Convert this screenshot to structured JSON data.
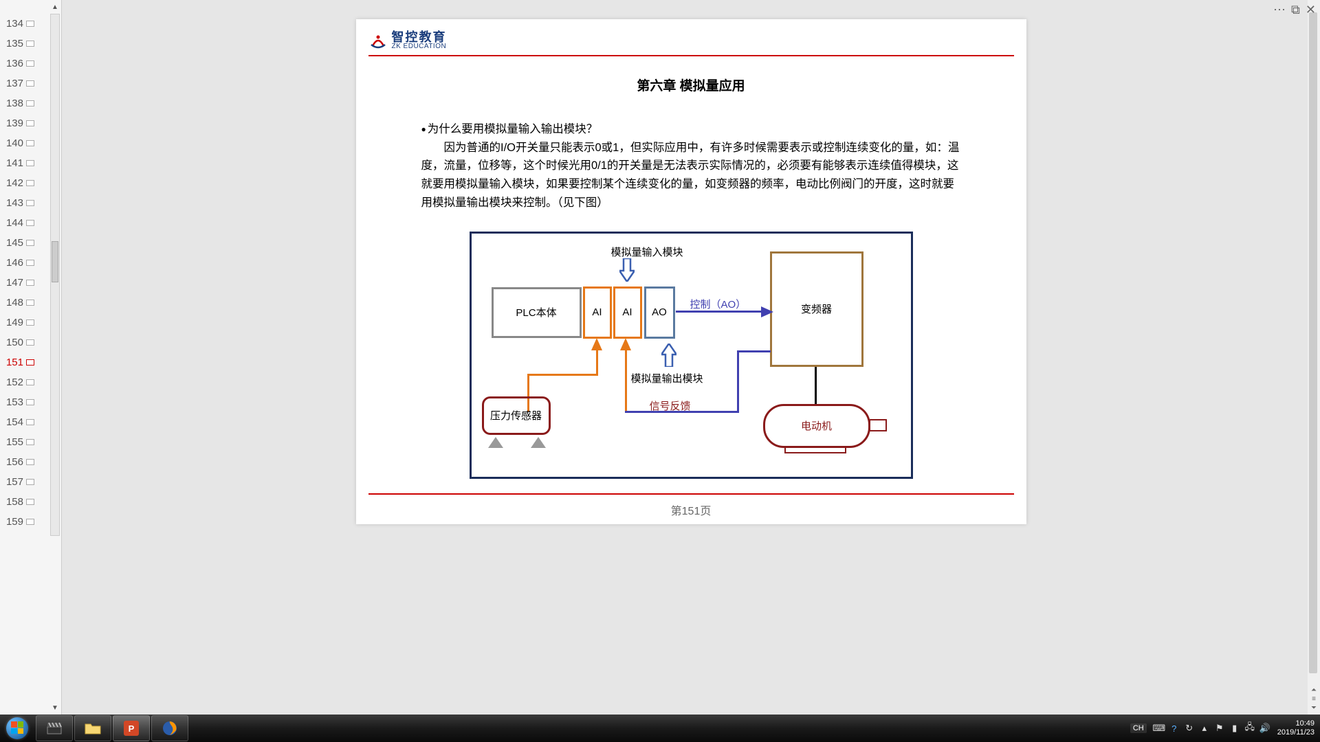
{
  "topControls": {
    "more": "⋯",
    "max": "⧉",
    "close": "✕"
  },
  "thumbs": {
    "start": 134,
    "end": 159,
    "active": 151
  },
  "slide": {
    "logo": {
      "cn": "智控教育",
      "en": "ZK EDUCATION"
    },
    "title": "第六章 模拟量应用",
    "question": "为什么要用模拟量输入输出模块？",
    "body": "因为普通的I/O开关量只能表示0或1，但实际应用中，有许多时候需要表示或控制连续变化的量，如：温度，流量，位移等，这个时候光用0/1的开关量是无法表示实际情况的，必须要有能够表示连续值得模块，这就要用模拟量输入模块，如果要控制某个连续变化的量，如变频器的频率，电动比例阀门的开度，这时就要用模拟量输出模块来控制。（见下图）",
    "diagram": {
      "ai_in_label": "模拟量输入模块",
      "plc": "PLC本体",
      "ai": "AI",
      "ao": "AO",
      "vfd": "变频器",
      "ctrl": "控制（AO）",
      "ao_out_label": "模拟量输出模块",
      "feedback": "信号反馈",
      "sensor": "压力传感器",
      "motor": "电动机"
    },
    "footer": "第151页"
  },
  "taskbar": {
    "lang": "CH",
    "time": "10:49",
    "date": "2019/11/23"
  }
}
